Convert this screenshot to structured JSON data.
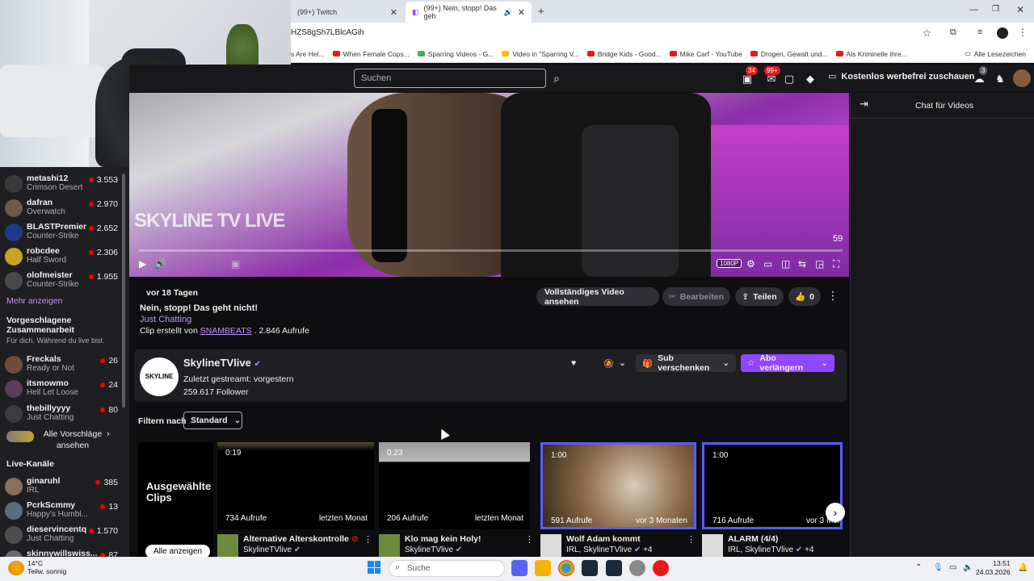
{
  "browser": {
    "tabs": [
      {
        "title": "(99+) Twitch"
      },
      {
        "title": "(99+) Nein, stopp! Das geh"
      }
    ],
    "url": "HZS8gSh7LBlcAGih",
    "bookmarks": [
      "s Are Hel...",
      "When Female Cops...",
      "Sparring Videos - G...",
      "Video in \"Sparring V...",
      "Bridge Kids - Good...",
      "Mike Carf - YouTube",
      "Drogen, Gewalt und...",
      "Als Kriminelle ihre..."
    ],
    "all_bookmarks": "Alle Lesezeichen"
  },
  "topnav": {
    "search_placeholder": "Suchen",
    "notif_count": "34",
    "inbox_count": "99+",
    "drops_count": "3",
    "free_view": "Kostenlos werbefrei zuschauen"
  },
  "sidebar": {
    "followed": [
      {
        "name": "metashi12",
        "game": "Crimson Desert",
        "viewers": "3.553"
      },
      {
        "name": "dafran",
        "game": "Overwatch",
        "viewers": "2.970"
      },
      {
        "name": "BLASTPremier",
        "game": "Counter-Strike",
        "viewers": "2.652"
      },
      {
        "name": "robcdee",
        "game": "Half Sword",
        "viewers": "2.306"
      },
      {
        "name": "olofmeister",
        "game": "Counter-Strike",
        "viewers": "1.955"
      }
    ],
    "show_more": "Mehr anzeigen",
    "suggested_header": "Vorgeschlagene Zusammenarbeit",
    "suggested_sub": "Für dich. Während du live bist.",
    "suggested": [
      {
        "name": "Freckals",
        "game": "Ready or Not",
        "viewers": "26"
      },
      {
        "name": "itsmowmo",
        "game": "Hell Let Loose",
        "viewers": "24"
      },
      {
        "name": "thebillyyyy",
        "game": "Just Chatting",
        "viewers": "80"
      }
    ],
    "all_suggestions": "Alle Vorschläge ansehen",
    "live_header": "Live-Kanäle",
    "live": [
      {
        "name": "ginaruhl",
        "game": "IRL",
        "viewers": "385"
      },
      {
        "name": "PcrkScmmy",
        "game": "Happy's Humbl...",
        "viewers": "13"
      },
      {
        "name": "dieservincentq",
        "game": "Just Chatting",
        "viewers": "1.570"
      },
      {
        "name": "skinnywillswiss...",
        "game": "",
        "viewers": "87"
      }
    ]
  },
  "video": {
    "watermark": "SKYLINE TV LIVE",
    "time_left": "59",
    "quality": "1080P"
  },
  "clip": {
    "ago": "vor 18 Tagen",
    "title": "Nein, stopp! Das geht nicht!",
    "category": "Just Chatting",
    "created_by_prefix": "Clip erstellt von",
    "creator": "SNAMBEATS",
    "views": ". 2.846 Aufrufe",
    "full_video": "Vollständiges Video ansehen",
    "edit": "Bearbeiten",
    "share": "Teilen",
    "likes": "0"
  },
  "channel": {
    "name": "SkylineTVlive",
    "last_streamed": "Zuletzt gestreamt: vorgestern",
    "followers": "259.617 Follower",
    "gift_sub": "Sub verschenken",
    "renew_sub": "Abo verlängern"
  },
  "filter": {
    "label": "Filtern nach",
    "value": "Standard"
  },
  "featured": {
    "title": "Ausgewählte Clips",
    "button": "Alle anzeigen"
  },
  "clips": [
    {
      "duration": "0:19",
      "views": "734 Aufrufe",
      "when": "letzten Monat",
      "title": "Alternative Alterskontrolle",
      "channel": "SkylineTVlive"
    },
    {
      "duration": "0:23",
      "views": "206 Aufrufe",
      "when": "letzten Monat",
      "title": "Klo mag kein Holy!",
      "channel": "SkylineTVlive"
    },
    {
      "duration": "1:00",
      "views": "591 Aufrufe",
      "when": "vor 3 Monaten",
      "title": "Wolf Adam kommt",
      "channel": "IRL, SkylineTVlive",
      "extra": "+4"
    },
    {
      "duration": "1:00",
      "views": "716 Aufrufe",
      "when": "vor 3 Mona",
      "title": "ALARM (4/4)",
      "channel": "IRL, SkylineTVlive",
      "extra": "+4"
    }
  ],
  "chat": {
    "title": "Chat für Videos"
  },
  "taskbar": {
    "temp": "14°C",
    "weather": "Teilw. sonnig",
    "search": "Suche",
    "time": "13:51",
    "date": "24.03.2026"
  },
  "colors": {
    "twitch_purple": "#9147ff",
    "live_red": "#eb0400",
    "link_purple": "#bf94ff"
  }
}
